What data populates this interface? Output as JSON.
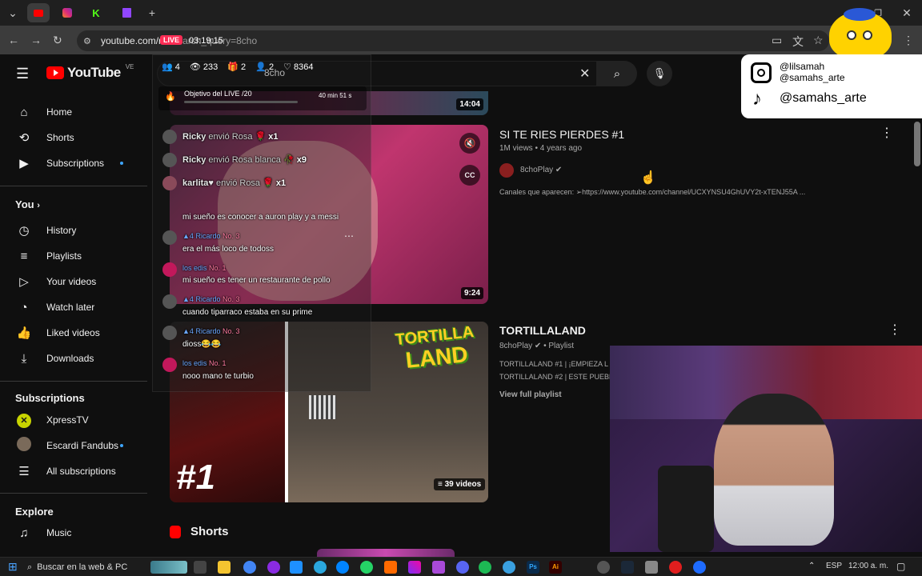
{
  "browser": {
    "url": "youtube.com/re",
    "url_suffix": "?search_query=8cho"
  },
  "youtube": {
    "logo_text": "YouTube",
    "country": "VE",
    "search_value": "8cho"
  },
  "sidebar": {
    "main": [
      {
        "label": "Home",
        "icon": "home-icon"
      },
      {
        "label": "Shorts",
        "icon": "shorts-icon"
      },
      {
        "label": "Subscriptions",
        "icon": "subscriptions-icon"
      }
    ],
    "you_header": "You",
    "you": [
      {
        "label": "History",
        "icon": "history-icon"
      },
      {
        "label": "Playlists",
        "icon": "playlists-icon"
      },
      {
        "label": "Your videos",
        "icon": "your-videos-icon"
      },
      {
        "label": "Watch later",
        "icon": "watch-later-icon"
      },
      {
        "label": "Liked videos",
        "icon": "liked-icon"
      },
      {
        "label": "Downloads",
        "icon": "download-icon"
      }
    ],
    "subs_header": "Subscriptions",
    "subs": [
      {
        "label": "XpressTV"
      },
      {
        "label": "Escardi Fandubs"
      },
      {
        "label": "All subscriptions"
      }
    ],
    "explore_header": "Explore",
    "explore": [
      {
        "label": "Music",
        "icon": "music-icon"
      }
    ]
  },
  "results": {
    "top_duration": "14:04",
    "video1": {
      "title": "SI TE RIES PIERDES #1",
      "views": "1M views",
      "age": "4 years ago",
      "channel": "8choPlay",
      "desc": "Canales que aparecen: ➢https://www.youtube.com/channel/UCXYNSU4GhUVY2t-xTENJ55A ...",
      "duration": "9:24"
    },
    "playlist": {
      "title": "TORTILLALAND",
      "channel": "8choPlay",
      "type": "Playlist",
      "desc_line1": "TORTILLALAND #1 | ¡EMPIEZA L",
      "desc_line2": "TORTILLALAND #2 | ESTE PUEBL",
      "view_full": "View full playlist",
      "count": "39 videos",
      "thumb_text": "#1",
      "logo_line1": "TORTILLA",
      "logo_line2": "LAND"
    },
    "shorts_header": "Shorts"
  },
  "stream_overlay": {
    "live_badge": "LIVE",
    "timer": "03:19:15",
    "stats": {
      "viewers_a": "4",
      "viewers_b": "233",
      "gifts": "2",
      "users": "2",
      "likes": "8364"
    },
    "goal_title": "Objetivo del LIVE",
    "goal_progress": "/20",
    "goal_time": "40 min 51 s",
    "chat": [
      {
        "name": "Ricky",
        "text": "envió Rosa",
        "count": "x1"
      },
      {
        "name": "Ricky",
        "text": "envió Rosa blanca",
        "count": "x9"
      },
      {
        "name": "karlita♥",
        "text": "envió Rosa",
        "count": "x1"
      },
      {
        "msg": "mi sueño es conocer a auron play y a messi"
      },
      {
        "badge": "4",
        "name": "Ricardo",
        "rank": "No. 3",
        "msg": "era el más loco de todoss"
      },
      {
        "name": "los edis",
        "rank": "No. 1",
        "msg": "mi sueño es tener un restaurante de pollo"
      },
      {
        "badge": "4",
        "name": "Ricardo",
        "rank": "No. 3",
        "msg": "cuando tiparraco estaba en su prime"
      },
      {
        "badge": "4",
        "name": "Ricardo",
        "rank": "No. 3",
        "msg": "dioss😂😂"
      },
      {
        "name": "los edis",
        "rank": "No. 1",
        "msg": "nooo mano te turbio"
      }
    ]
  },
  "social": {
    "instagram_1": "@lilsamah",
    "instagram_2": "@samahs_arte",
    "tiktok": "@samahs_arte"
  },
  "taskbar": {
    "search": "Buscar en la web & PC",
    "lang": "ESP",
    "clock": "12:00 a. m."
  },
  "colors": {
    "bg": "#0f0f0f",
    "yt_red": "#ff0000",
    "link_blue": "#3ea6ff"
  }
}
